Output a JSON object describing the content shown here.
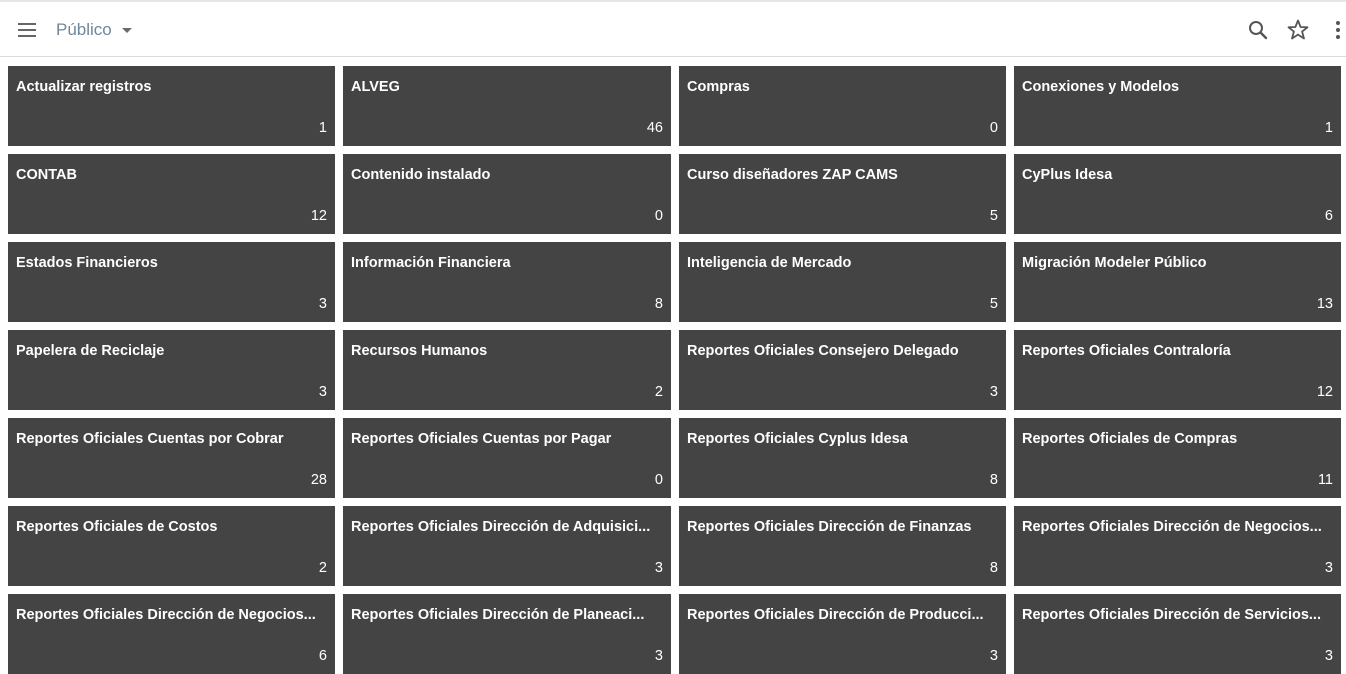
{
  "header": {
    "title": "Público",
    "menu_icon": "hamburger-menu-icon",
    "search_icon": "search-icon",
    "favorite_icon": "star-outline-icon",
    "more_icon": "more-vertical-icon"
  },
  "colors": {
    "tile_background": "#444444",
    "tile_text": "#ffffff",
    "title_text": "#6f8799"
  },
  "tiles": [
    {
      "name": "Actualizar registros",
      "count": "1"
    },
    {
      "name": "ALVEG",
      "count": "46"
    },
    {
      "name": "Compras",
      "count": "0"
    },
    {
      "name": "Conexiones y Modelos",
      "count": "1"
    },
    {
      "name": "CONTAB",
      "count": "12"
    },
    {
      "name": "Contenido instalado",
      "count": "0"
    },
    {
      "name": "Curso diseñadores ZAP CAMS",
      "count": "5"
    },
    {
      "name": "CyPlus Idesa",
      "count": "6"
    },
    {
      "name": "Estados Financieros",
      "count": "3"
    },
    {
      "name": "Información Financiera",
      "count": "8"
    },
    {
      "name": "Inteligencia de Mercado",
      "count": "5"
    },
    {
      "name": "Migración Modeler Público",
      "count": "13"
    },
    {
      "name": "Papelera de Reciclaje",
      "count": "3"
    },
    {
      "name": "Recursos Humanos",
      "count": "2"
    },
    {
      "name": "Reportes Oficiales Consejero Delegado",
      "count": "3"
    },
    {
      "name": "Reportes Oficiales Contraloría",
      "count": "12"
    },
    {
      "name": "Reportes Oficiales Cuentas por Cobrar",
      "count": "28"
    },
    {
      "name": "Reportes Oficiales Cuentas por Pagar",
      "count": "0"
    },
    {
      "name": "Reportes Oficiales Cyplus Idesa",
      "count": "8"
    },
    {
      "name": "Reportes Oficiales de Compras",
      "count": "11"
    },
    {
      "name": "Reportes Oficiales de Costos",
      "count": "2"
    },
    {
      "name": "Reportes Oficiales Dirección de Adquisici...",
      "count": "3"
    },
    {
      "name": "Reportes Oficiales Dirección de Finanzas",
      "count": "8"
    },
    {
      "name": "Reportes Oficiales Dirección de Negocios...",
      "count": "3"
    },
    {
      "name": "Reportes Oficiales Dirección de Negocios...",
      "count": "6"
    },
    {
      "name": "Reportes Oficiales Dirección de Planeaci...",
      "count": "3"
    },
    {
      "name": "Reportes Oficiales Dirección de Producci...",
      "count": "3"
    },
    {
      "name": "Reportes Oficiales Dirección de Servicios...",
      "count": "3"
    }
  ]
}
